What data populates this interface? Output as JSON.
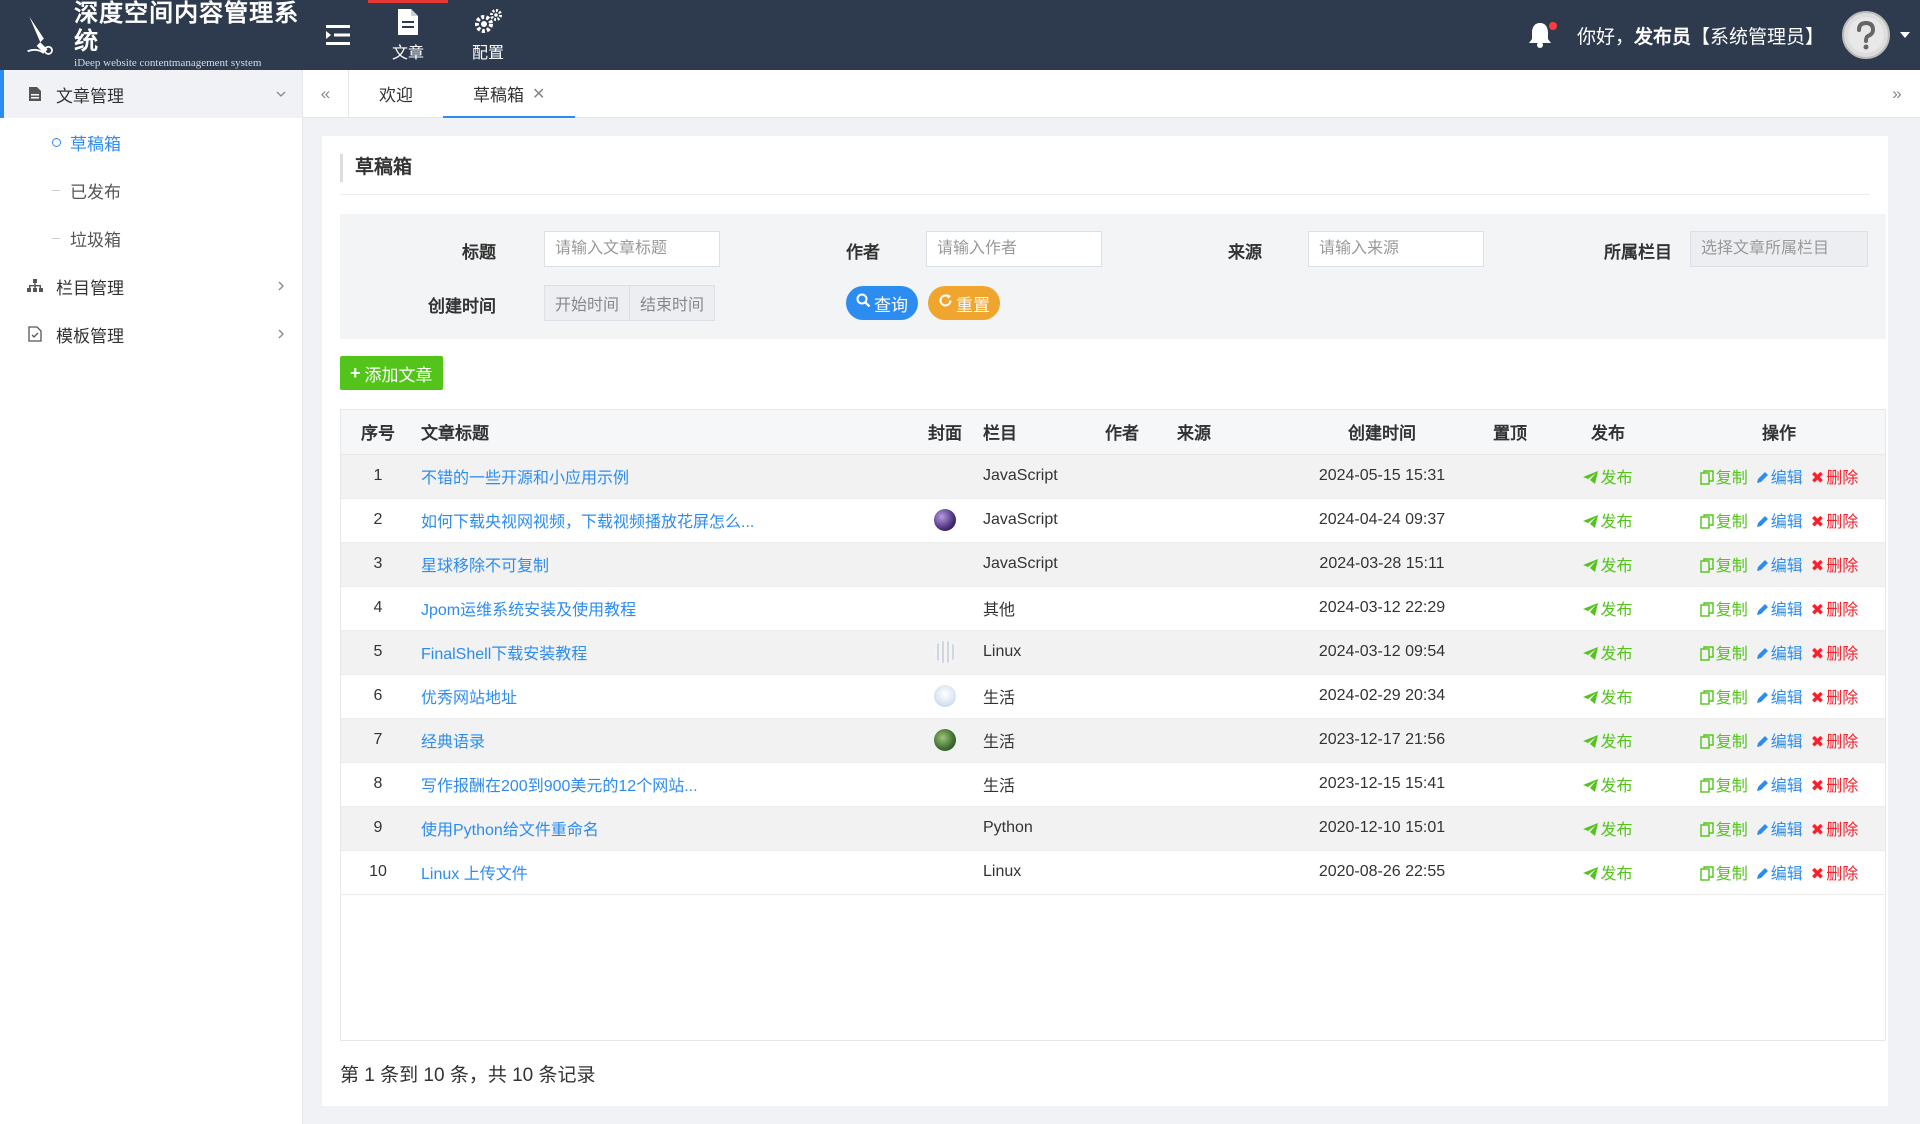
{
  "header": {
    "logo_title": "深度空间内容管理系统",
    "logo_sub": "iDeep website contentmanagement system",
    "nav": [
      {
        "label": "文章",
        "icon": "document-icon",
        "active": true
      },
      {
        "label": "配置",
        "icon": "gears-icon",
        "active": false
      }
    ],
    "greeting_prefix": "你好，",
    "user_name": "发布员",
    "user_role": "【系统管理员】",
    "colors": {
      "bg": "#2e3a4d",
      "accent": "#e53935"
    }
  },
  "sidebar": {
    "groups": [
      {
        "label": "文章管理",
        "icon": "file-icon",
        "expanded": true,
        "items": [
          {
            "label": "草稿箱",
            "active": true
          },
          {
            "label": "已发布",
            "active": false
          },
          {
            "label": "垃圾箱",
            "active": false
          }
        ]
      },
      {
        "label": "栏目管理",
        "icon": "sitemap-icon",
        "expanded": false
      },
      {
        "label": "模板管理",
        "icon": "template-icon",
        "expanded": false
      }
    ]
  },
  "tabs": [
    {
      "label": "欢迎",
      "active": false
    },
    {
      "label": "草稿箱",
      "active": true,
      "closable": true
    }
  ],
  "panel": {
    "title": "草稿箱",
    "search": {
      "title_label": "标题",
      "title_placeholder": "请输入文章标题",
      "author_label": "作者",
      "author_placeholder": "请输入作者",
      "source_label": "来源",
      "source_placeholder": "请输入来源",
      "column_label": "所属栏目",
      "column_placeholder": "选择文章所属栏目",
      "time_label": "创建时间",
      "start_placeholder": "开始时间",
      "end_placeholder": "结束时间",
      "query_label": "查询",
      "reset_label": "重置"
    },
    "add_label": "添加文章",
    "columns": [
      "序号",
      "文章标题",
      "封面",
      "栏目",
      "作者",
      "来源",
      "创建时间",
      "置顶",
      "发布",
      "操作"
    ],
    "rows": [
      {
        "idx": "1",
        "title": "不错的一些开源和小应用示例",
        "cover": "",
        "column": "JavaScript",
        "author": "",
        "source": "",
        "time": "2024-05-15 15:31",
        "top": ""
      },
      {
        "idx": "2",
        "title": "如何下载央视网视频，下载视频播放花屏怎么...",
        "cover": "purple",
        "column": "JavaScript",
        "author": "",
        "source": "",
        "time": "2024-04-24 09:37",
        "top": ""
      },
      {
        "idx": "3",
        "title": "星球移除不可复制",
        "cover": "",
        "column": "JavaScript",
        "author": "",
        "source": "",
        "time": "2024-03-28 15:11",
        "top": ""
      },
      {
        "idx": "4",
        "title": "Jpom运维系统安装及使用教程",
        "cover": "",
        "column": "其他",
        "author": "",
        "source": "",
        "time": "2024-03-12 22:29",
        "top": ""
      },
      {
        "idx": "5",
        "title": "FinalShell下载安装教程",
        "cover": "light",
        "column": "Linux",
        "author": "",
        "source": "",
        "time": "2024-03-12 09:54",
        "top": ""
      },
      {
        "idx": "6",
        "title": "优秀网站地址",
        "cover": "cloud",
        "column": "生活",
        "author": "",
        "source": "",
        "time": "2024-02-29 20:34",
        "top": ""
      },
      {
        "idx": "7",
        "title": "经典语录",
        "cover": "green",
        "column": "生活",
        "author": "",
        "source": "",
        "time": "2023-12-17 21:56",
        "top": ""
      },
      {
        "idx": "8",
        "title": "写作报酬在200到900美元的12个网站...",
        "cover": "",
        "column": "生活",
        "author": "",
        "source": "",
        "time": "2023-12-15 15:41",
        "top": ""
      },
      {
        "idx": "9",
        "title": "使用Python给文件重命名",
        "cover": "",
        "column": "Python",
        "author": "",
        "source": "",
        "time": "2020-12-10 15:01",
        "top": ""
      },
      {
        "idx": "10",
        "title": "Linux 上传文件",
        "cover": "",
        "column": "Linux",
        "author": "",
        "source": "",
        "time": "2020-08-26 22:55",
        "top": ""
      }
    ],
    "actions": {
      "publish": "发布",
      "copy": "复制",
      "edit": "编辑",
      "delete": "删除"
    },
    "pager_text": "第 1 条到 10 条，共 10 条记录"
  }
}
